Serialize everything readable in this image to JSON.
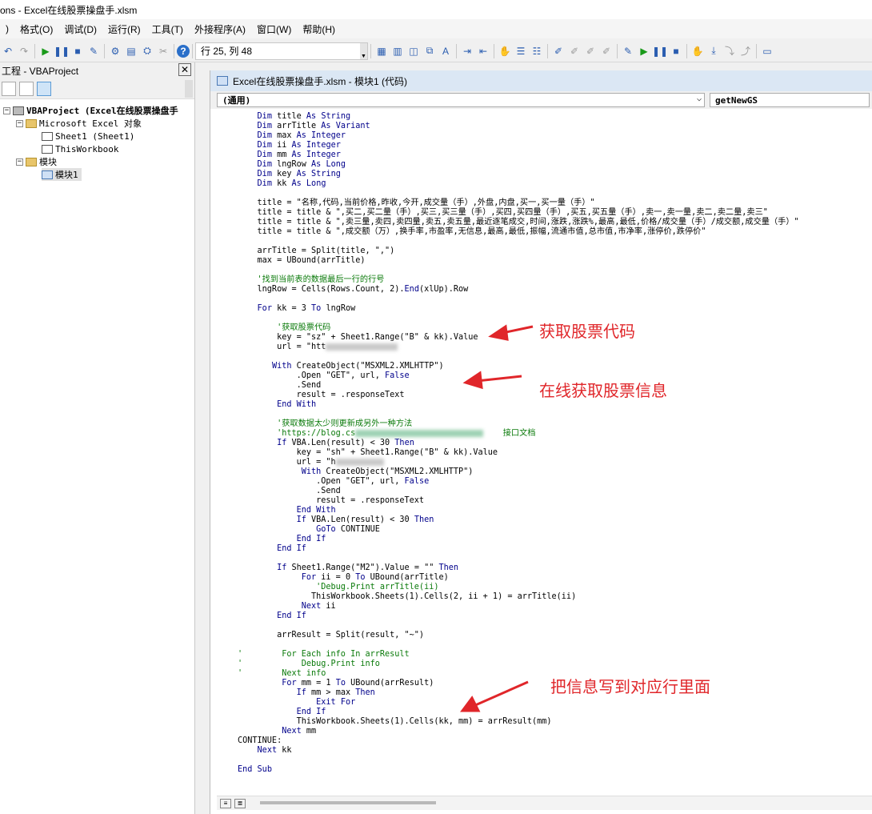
{
  "window": {
    "title": "ons - Excel在线股票操盘手.xlsm"
  },
  "menu": [
    ")",
    "格式(O)",
    "调试(D)",
    "运行(R)",
    "工具(T)",
    "外接程序(A)",
    "窗口(W)",
    "帮助(H)"
  ],
  "toolbar": {
    "position": "行 25, 列 48"
  },
  "project": {
    "title": "工程 - VBAProject",
    "close": "✕",
    "tree": {
      "root": "VBAProject (Excel在线股票操盘手",
      "excel_objects": "Microsoft Excel 对象",
      "sheet1": "Sheet1 (Sheet1)",
      "thisworkbook": "ThisWorkbook",
      "modules": "模块",
      "module1": "模块1"
    }
  },
  "codewin": {
    "title": "Excel在线股票操盘手.xlsm - 模块1 (代码)",
    "combo_left": "(通用)",
    "combo_right": "getNewGS"
  },
  "code": [
    "    Dim title As String",
    "    Dim arrTitle As Variant",
    "    Dim max As Integer",
    "    Dim ii As Integer",
    "    Dim mm As Integer",
    "    Dim lngRow As Long",
    "    Dim key As String",
    "    Dim kk As Long",
    "",
    "    title = \"名称,代码,当前价格,昨收,今开,成交量（手）,外盘,内盘,买一,买一量（手）\"",
    "    title = title & \",买二,买二量（手）,买三,买三量（手）,买四,买四量（手）,买五,买五量（手）,卖一,卖一量,卖二,卖二量,卖三\"",
    "    title = title & \",卖三量,卖四,卖四量,卖五,卖五量,最近逐笔成交,时间,涨跌,涨跌%,最高,最低,价格/成交量（手）/成交额,成交量（手）\"",
    "    title = title & \",成交额（万）,换手率,市盈率,无信息,最高,最低,振幅,流通市值,总市值,市净率,涨停价,跌停价\"",
    "",
    "    arrTitle = Split(title, \",\")",
    "    max = UBound(arrTitle)",
    "",
    "    '找到当前表的数据最后一行的行号",
    "    lngRow = Cells(Rows.Count, 2).End(xlUp).Row",
    "",
    "    For kk = 3 To lngRow",
    "",
    "        '获取股票代码",
    "        key = \"sz\" + Sheet1.Range(\"B\" & kk).Value",
    "        url = \"htt",
    "",
    "       With CreateObject(\"MSXML2.XMLHTTP\")",
    "            .Open \"GET\", url, False",
    "            .Send",
    "            result = .responseText",
    "        End With",
    "",
    "        '获取数据太少则更新成另外一种方法",
    "        'https://blog.cs",
    "        If VBA.Len(result) < 30 Then",
    "            key = \"sh\" + Sheet1.Range(\"B\" & kk).Value",
    "            url = \"h",
    "             With CreateObject(\"MSXML2.XMLHTTP\")",
    "                .Open \"GET\", url, False",
    "                .Send",
    "                result = .responseText",
    "            End With",
    "            If VBA.Len(result) < 30 Then",
    "                GoTo CONTINUE",
    "            End If",
    "        End If",
    "",
    "        If Sheet1.Range(\"M2\").Value = \"\" Then",
    "             For ii = 0 To UBound(arrTitle)",
    "                'Debug.Print arrTitle(ii)",
    "               ThisWorkbook.Sheets(1).Cells(2, ii + 1) = arrTitle(ii)",
    "             Next ii",
    "        End If",
    "",
    "        arrResult = Split(result, \"~\")",
    "",
    "'        For Each info In arrResult",
    "'            Debug.Print info",
    "'        Next info",
    "         For mm = 1 To UBound(arrResult)",
    "            If mm > max Then",
    "                Exit For",
    "            End If",
    "            ThisWorkbook.Sheets(1).Cells(kk, mm) = arrResult(mm)",
    "         Next mm",
    "CONTINUE:",
    "    Next kk",
    "",
    "End Sub"
  ],
  "annotations": {
    "a1": "获取股票代码",
    "a2": "在线获取股票信息",
    "a3": "把信息写到对应行里面",
    "doc": "接口文档"
  }
}
